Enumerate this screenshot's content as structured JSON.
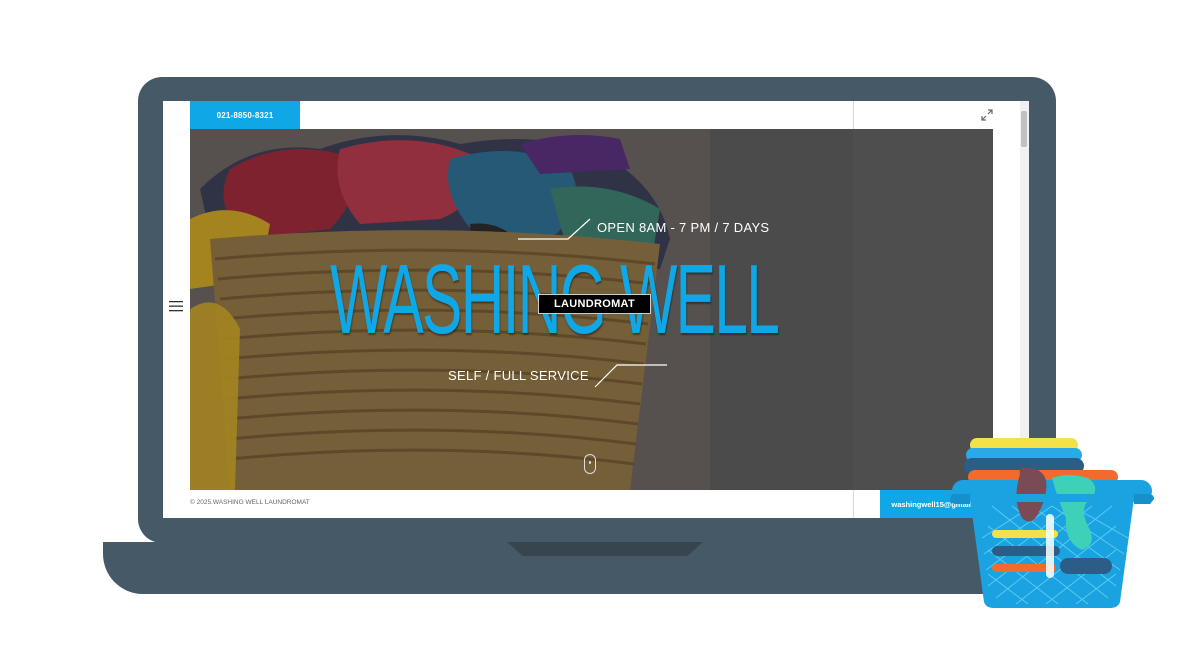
{
  "site": {
    "phone": "021-8850-8321",
    "email": "washingwell15@gmail.co",
    "copyright": "© 2025.WASHING WELL LAUNDROMAT"
  },
  "hero": {
    "hours": "OPEN 8AM - 7 PM / 7 DAYS",
    "title": "WASHING WELL",
    "subtitle": "LAUNDROMAT",
    "service": "SELF / FULL SERVICE"
  },
  "icons": {
    "menu": "hamburger-menu-icon",
    "expand": "expand-arrows-icon",
    "scroll": "mouse-scroll-icon"
  },
  "colors": {
    "accent": "#0fa7e6",
    "laptop": "#465966",
    "basket": "#1aa3e0"
  }
}
